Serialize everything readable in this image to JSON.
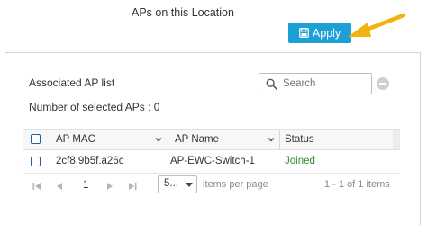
{
  "header": {
    "title": "APs on this Location",
    "apply_label": "Apply"
  },
  "panel": {
    "title": "Associated AP list",
    "selected_count_text": "Number of selected APs : 0",
    "search": {
      "placeholder": "Search",
      "value": ""
    }
  },
  "table": {
    "columns": [
      "AP MAC",
      "AP Name",
      "Status"
    ],
    "rows": [
      {
        "mac": "2cf8.9b5f.a26c",
        "name": "AP-EWC-Switch-1",
        "status": "Joined"
      }
    ]
  },
  "pagination": {
    "current_page": "1",
    "per_page": "5...",
    "per_page_label": "items per page",
    "range_text": "1 - 1 of 1 items"
  },
  "colors": {
    "apply_button": "#1e9fd6",
    "callout_arrow": "#f3b30f",
    "status_joined": "#2e8b2e",
    "checkbox_border": "#1d5fa6"
  },
  "icons": {
    "apply": "save-icon",
    "search": "search-icon",
    "clear": "clear-search-icon",
    "sort": "sort-icon",
    "pager": [
      "first-page-icon",
      "previous-page-icon",
      "next-page-icon",
      "last-page-icon"
    ]
  }
}
